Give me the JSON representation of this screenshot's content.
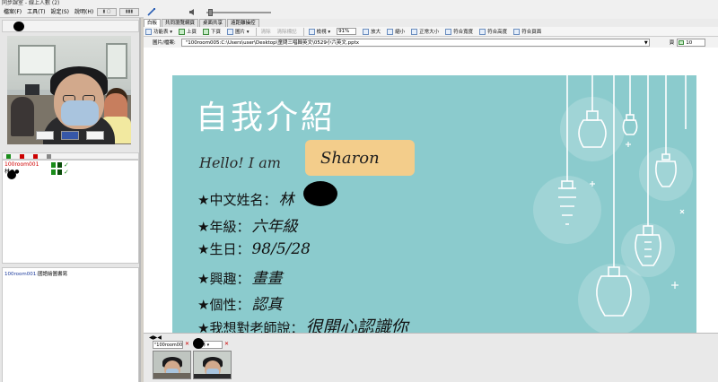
{
  "title_bar": {
    "title": "同步課室 - 線上人數 (2)"
  },
  "menubar": {
    "items": [
      "檔案(F)",
      "工具(T)",
      "設定(S)",
      "說明(H)"
    ]
  },
  "roster": {
    "rows": [
      {
        "name": "100room001",
        "color": "#d00000"
      },
      {
        "name": "林●●",
        "color": "#000000"
      }
    ]
  },
  "chat": {
    "sender": "100room001:",
    "text": "國語繪圖書寫"
  },
  "tabs": [
    "白板",
    "共同瀏覽網頁",
    "桌面共享",
    "遠距離操控"
  ],
  "toolbar": {
    "items": [
      {
        "label": "功能表 ▾",
        "disabled": false
      },
      {
        "label": "上頁",
        "disabled": false
      },
      {
        "label": "下頁",
        "disabled": false
      },
      {
        "label": "圖片 ▾",
        "disabled": false
      },
      {
        "label": "清除",
        "disabled": true
      },
      {
        "label": "清除標記",
        "disabled": true
      },
      {
        "label": "檢視 ▾",
        "disabled": false
      }
    ],
    "zoom": "91%",
    "items2": [
      {
        "label": "放大",
        "disabled": false
      },
      {
        "label": "縮小",
        "disabled": false
      },
      {
        "label": "正常大小",
        "disabled": false
      },
      {
        "label": "符合寬度",
        "disabled": false
      },
      {
        "label": "符合高度",
        "disabled": false
      },
      {
        "label": "符合頁面",
        "disabled": false
      }
    ]
  },
  "filebar": {
    "label": "圖片/檔案:",
    "path": "\"100room005:C:\\Users\\user\\Desktop\\童問三唱韓英文\\0529小六英文.pptx",
    "page_label": "頁",
    "page_value": "10"
  },
  "slide": {
    "title": "自我介紹",
    "hello": "Hello! I am",
    "name": "Sharon",
    "fields": [
      {
        "label": "★中文姓名：",
        "value": "林"
      },
      {
        "label": "★年級：",
        "value": "六年級"
      },
      {
        "label": "★生日：",
        "value": "98/5/28"
      },
      {
        "label": "★興趣：",
        "value": "畫畫"
      },
      {
        "label": "★個性：",
        "value": "認真"
      },
      {
        "label": "★我想對老師說：",
        "value": "很開心認識你"
      }
    ]
  },
  "thumbs": {
    "arrows": "◀▶◀",
    "sel1": "\"100room00 ▾",
    "sel2": "林 ▾"
  }
}
